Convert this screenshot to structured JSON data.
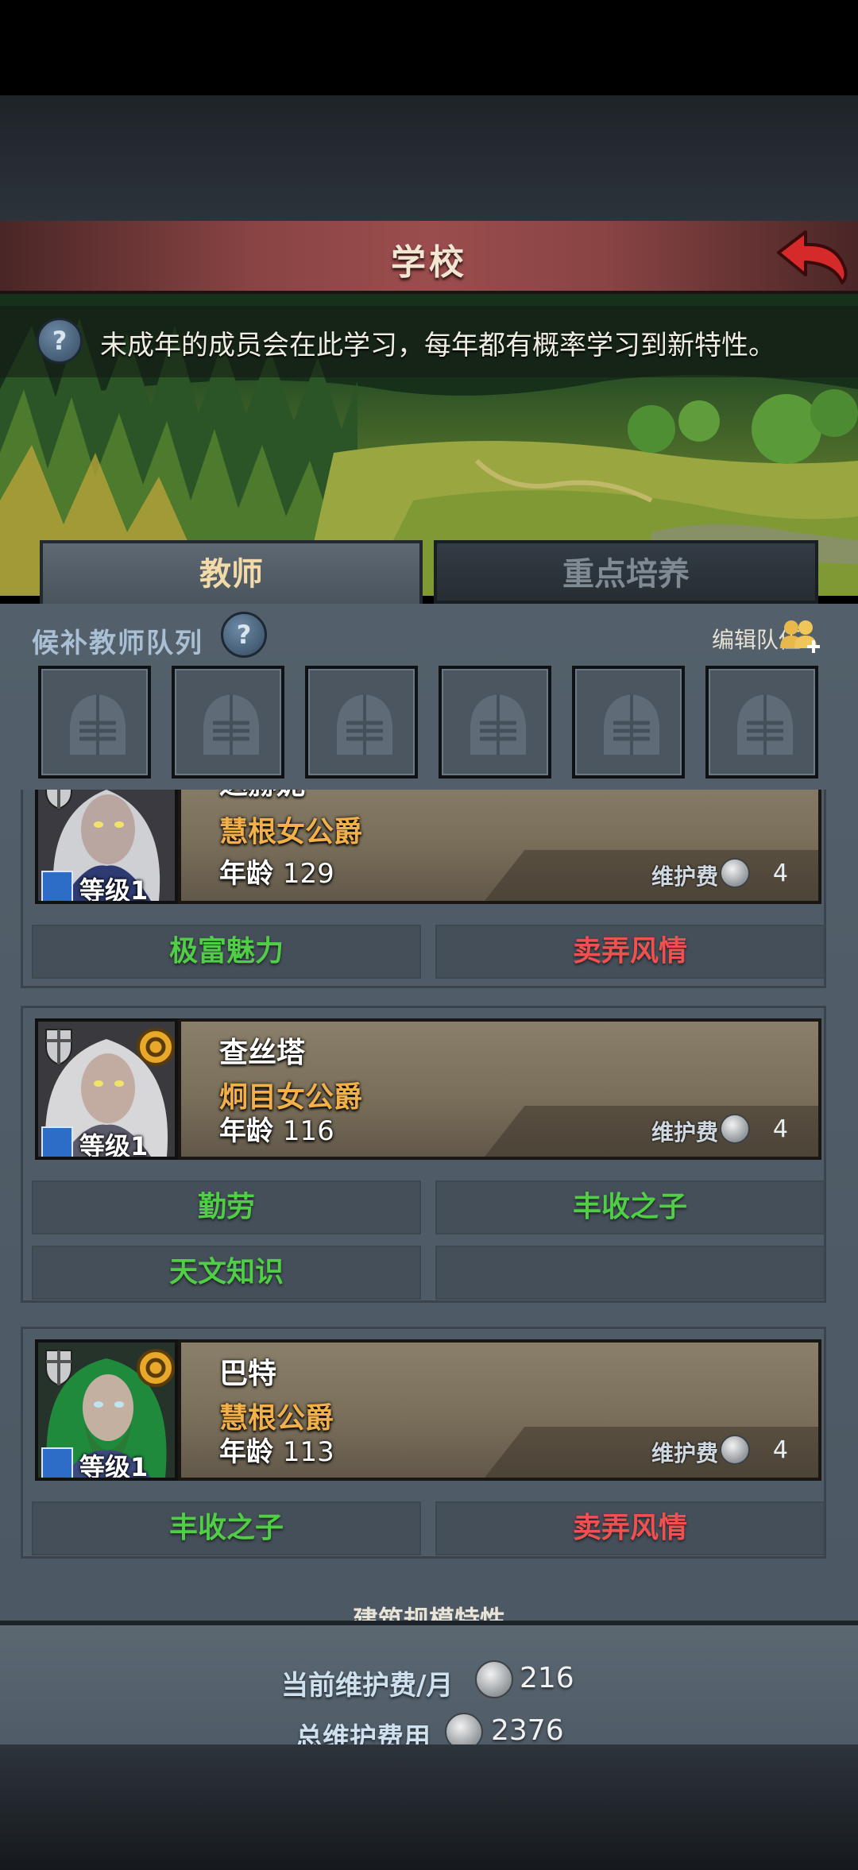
{
  "header": {
    "title": "学校"
  },
  "info": {
    "text": "未成年的成员会在此学习，每年都有概率学习到新特性。"
  },
  "tabs": [
    {
      "label": "教师"
    },
    {
      "label": "重点培养"
    }
  ],
  "queue": {
    "label": "候补教师队列",
    "edit_label": "编辑队伍",
    "slots": 6
  },
  "members": [
    {
      "name": "达赫妮",
      "title": "慧根女公爵",
      "level": "等级1",
      "age_label": "年龄",
      "age": "129",
      "upkeep_label": "维护费",
      "upkeep": "4",
      "traits": [
        "极富魅力",
        "卖弄风情"
      ]
    },
    {
      "name": "查丝塔",
      "title": "炯目女公爵",
      "level": "等级1",
      "age_label": "年龄",
      "age": "116",
      "upkeep_label": "维护费",
      "upkeep": "4",
      "traits": [
        "勤劳",
        "丰收之子",
        "天文知识",
        ""
      ]
    },
    {
      "name": "巴特",
      "title": "慧根公爵",
      "level": "等级1",
      "age_label": "年龄",
      "age": "113",
      "upkeep_label": "维护费",
      "upkeep": "4",
      "traits": [
        "丰收之子",
        "卖弄风情"
      ]
    }
  ],
  "next_section": "建筑规模特性",
  "footer": {
    "monthly_label": "当前维护费/月",
    "monthly_value": "216",
    "total_label": "总维护费用",
    "total_value": "2376"
  },
  "colors": {
    "trait_good": "#4fce46",
    "trait_bad": "#ef5050",
    "title_gold": "#f2b04a"
  },
  "icons": [
    "help-icon",
    "back-arrow-icon",
    "knight-helmet-icon",
    "edit-team-icon",
    "shield-icon",
    "rank-icon",
    "sword-icon",
    "coin-icon"
  ]
}
